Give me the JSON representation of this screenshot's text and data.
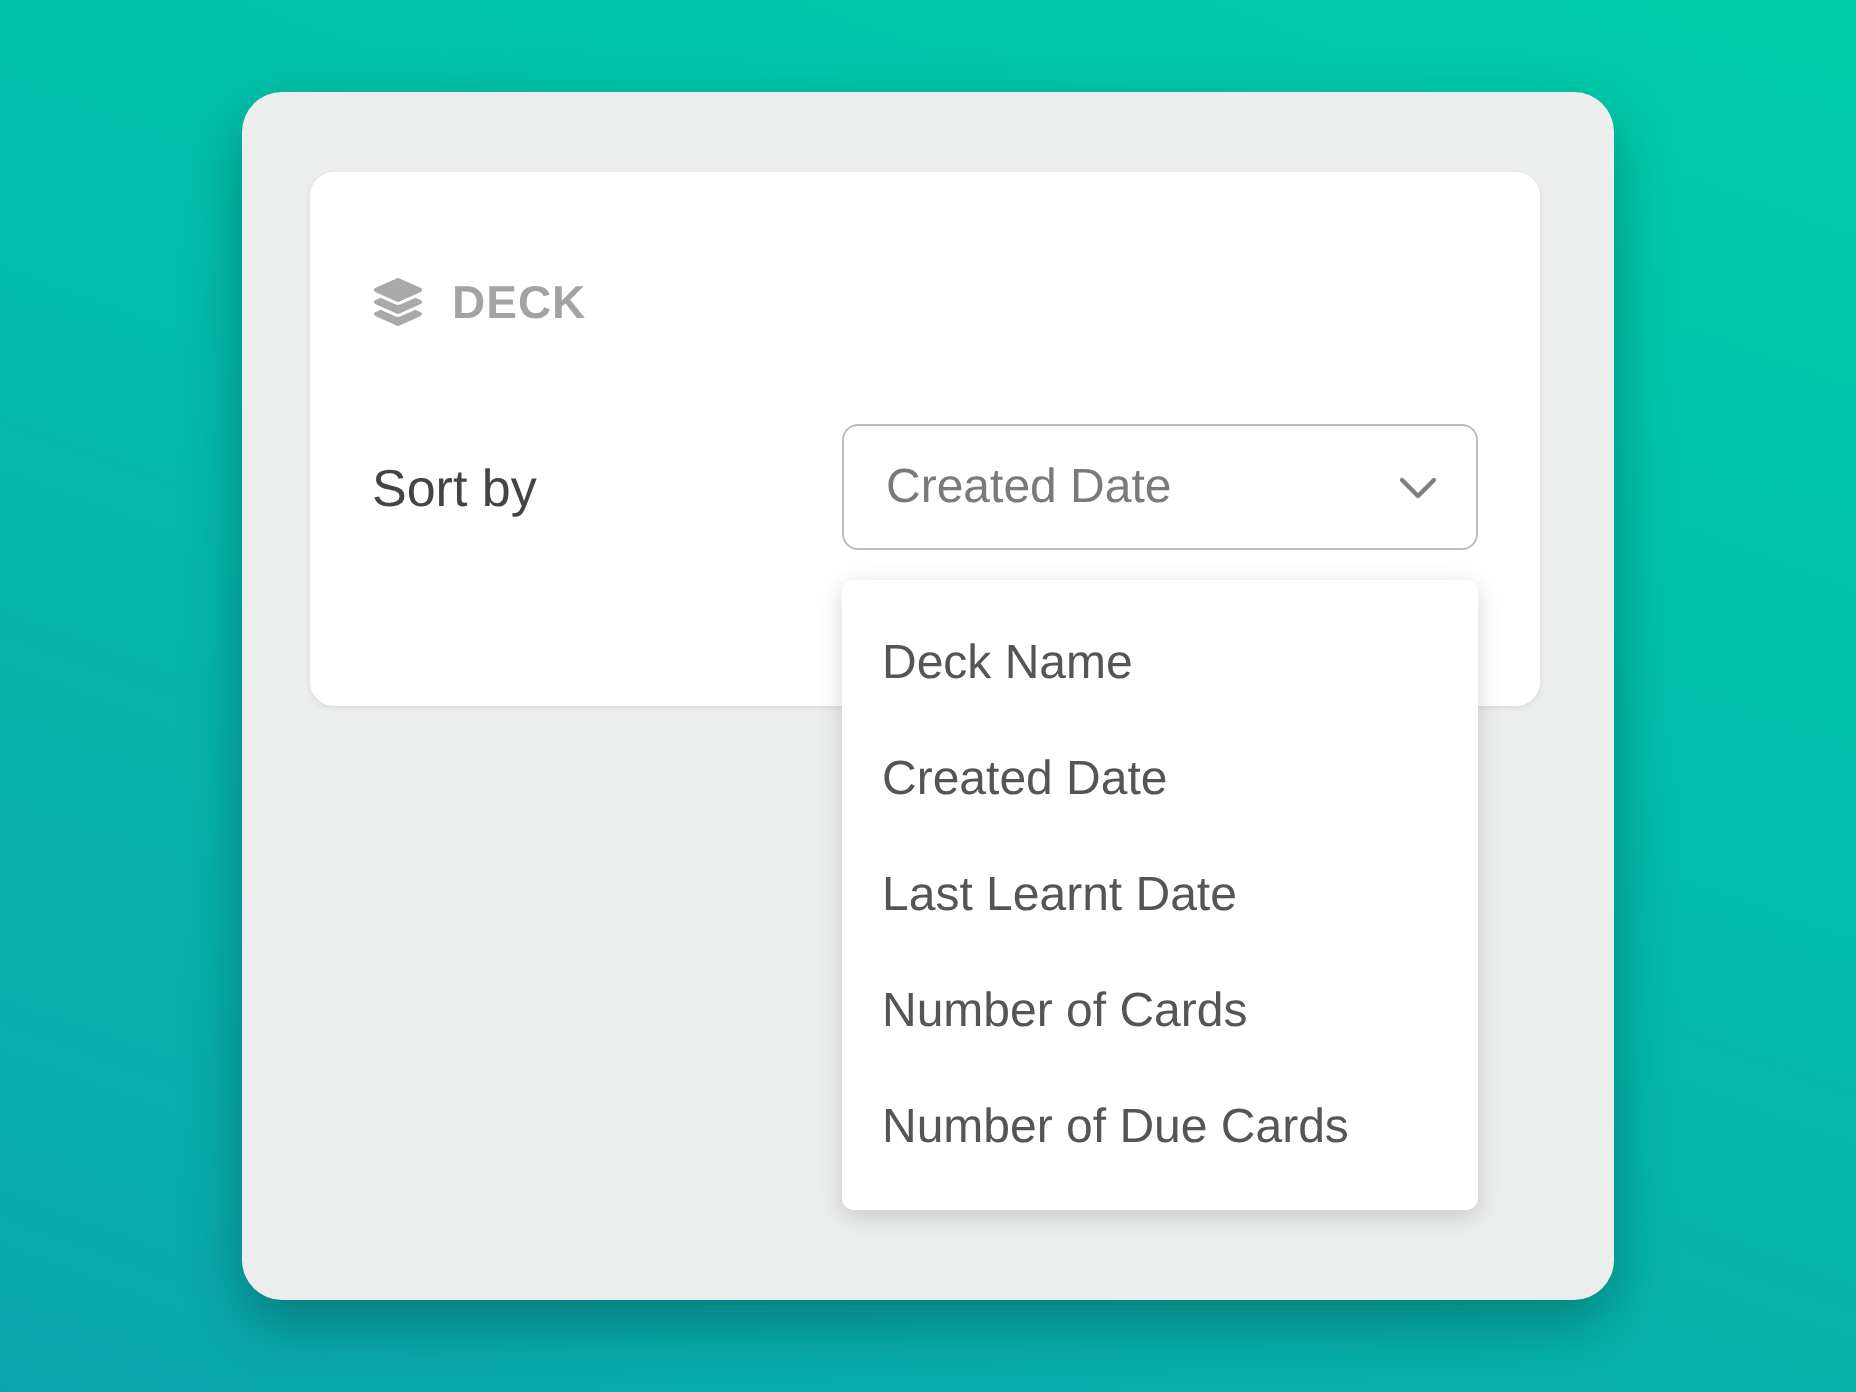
{
  "section": {
    "title": "DECK"
  },
  "sort": {
    "label": "Sort by",
    "value": "Created Date",
    "expanded": true
  },
  "options": [
    {
      "label": "Deck Name"
    },
    {
      "label": "Created Date"
    },
    {
      "label": "Last Learnt Date"
    },
    {
      "label": "Number of Cards"
    },
    {
      "label": "Number of Due Cards"
    }
  ]
}
